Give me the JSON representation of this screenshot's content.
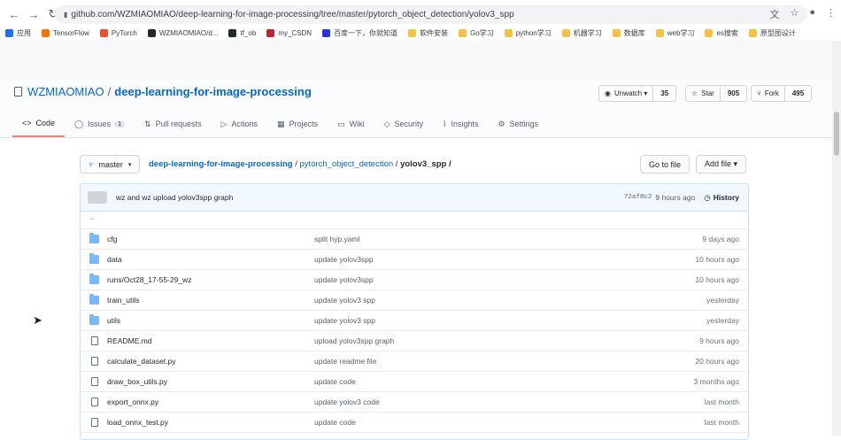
{
  "browser": {
    "address": "github.com/WZMIAOMIAO/deep-learning-for-image-processing/tree/master/pytorch_object_detection/yolov3_spp",
    "bookmarks": [
      "应用",
      "TensorFlow",
      "PyTorch",
      "WZMIAOMIAO/d...",
      "tf_ob",
      "my_CSDN",
      "百度一下，你就知道",
      "软件安装",
      "Go学习",
      "python学习",
      "机器学习",
      "数据库",
      "web学习",
      "es搜索",
      "原型图设计"
    ]
  },
  "repo": {
    "owner": "WZMIAOMIAO",
    "separator": "/",
    "name": "deep-learning-for-image-processing",
    "unwatch_label": "Unwatch ▾",
    "watch_count": "35",
    "star_label": "Star",
    "star_count": "905",
    "fork_label": "Fork",
    "fork_count": "495"
  },
  "tabs": [
    {
      "label": "Code",
      "icon": "<>"
    },
    {
      "label": "Issues",
      "badge": "1",
      "icon": "◯"
    },
    {
      "label": "Pull requests",
      "icon": "⇅"
    },
    {
      "label": "Actions",
      "icon": "▷"
    },
    {
      "label": "Projects",
      "icon": "▦"
    },
    {
      "label": "Wiki",
      "icon": "▭"
    },
    {
      "label": "Security",
      "icon": "◇"
    },
    {
      "label": "Insights",
      "icon": "⌇"
    },
    {
      "label": "Settings",
      "icon": "⚙"
    }
  ],
  "branch": {
    "label": "master",
    "crumb_repo": "deep-learning-for-image-processing",
    "crumb_dir": "pytorch_object_detection",
    "crumb_current": "yolov3_spp /",
    "goto_label": "Go to file",
    "add_label": "Add file ▾"
  },
  "commit": {
    "message": "wz and wz upload yolov3spp graph",
    "sha": "72af8c2",
    "age": "9 hours ago",
    "history_label": "History"
  },
  "parent_dir": "..",
  "files": [
    {
      "type": "dir",
      "name": "cfg",
      "message": "split hyp.yaml",
      "age": "9 days ago"
    },
    {
      "type": "dir",
      "name": "data",
      "message": "update yolov3spp",
      "age": "10 hours ago"
    },
    {
      "type": "dir",
      "name": "runs/Oct28_17-55-29_wz",
      "message": "update yolov3spp",
      "age": "10 hours ago"
    },
    {
      "type": "dir",
      "name": "train_utils",
      "message": "update yolov3 spp",
      "age": "yesterday"
    },
    {
      "type": "dir",
      "name": "utils",
      "message": "update yolov3 spp",
      "age": "yesterday"
    },
    {
      "type": "file",
      "name": "README.md",
      "message": "upload yolov3spp graph",
      "age": "9 hours ago"
    },
    {
      "type": "file",
      "name": "calculate_dataset.py",
      "message": "update readme file",
      "age": "20 hours ago"
    },
    {
      "type": "file",
      "name": "draw_box_utils.py",
      "message": "update code",
      "age": "3 months ago"
    },
    {
      "type": "file",
      "name": "export_onnx.py",
      "message": "update yolov3 code",
      "age": "last month"
    },
    {
      "type": "file",
      "name": "load_onnx_test.py",
      "message": "update code",
      "age": "last month"
    }
  ]
}
